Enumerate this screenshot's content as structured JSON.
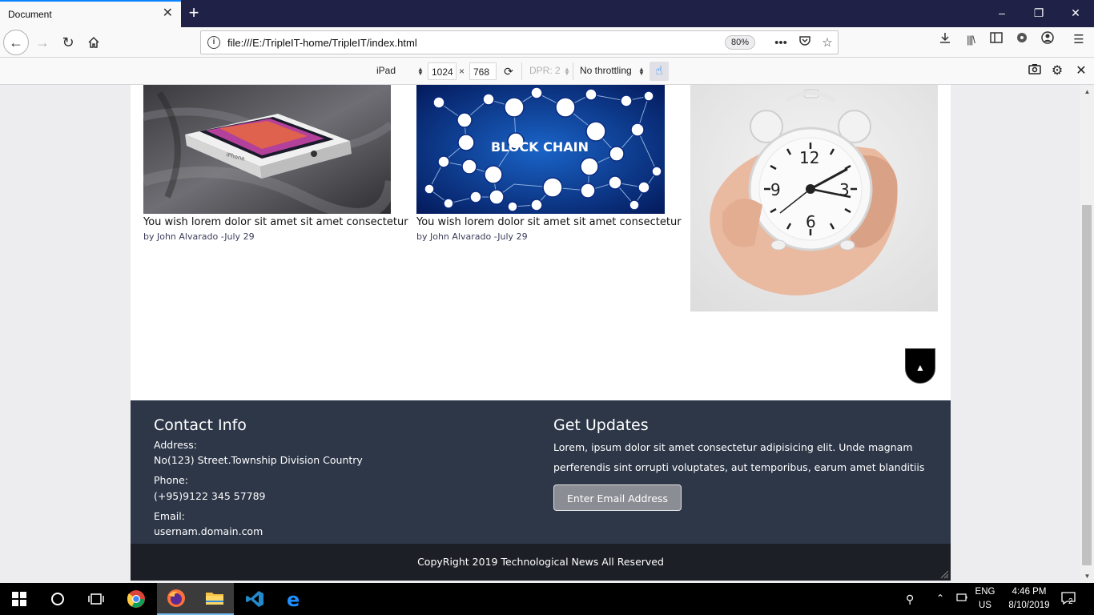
{
  "browser": {
    "tab_title": "Document",
    "url": "file:///E:/TripleIT-home/TripleIT/index.html",
    "zoom": "80%"
  },
  "rdm": {
    "device": "iPad",
    "width": "1024",
    "height": "768",
    "times": "×",
    "dpr": "DPR: 2",
    "throttling": "No throttling"
  },
  "page": {
    "cards": [
      {
        "title": "You wish lorem dolor sit amet sit amet consectetur",
        "meta": "by John Alvarado -July 29",
        "image": "iphone-box-photo"
      },
      {
        "title": "You wish lorem dolor sit amet sit amet consectetur",
        "meta": "by John Alvarado -July 29",
        "image": "blockchain-network-graphic",
        "image_text": "BLOCK CHAIN"
      },
      {
        "image": "alarm-clock-photo"
      }
    ],
    "footer": {
      "contact_heading": "Contact Info",
      "address_label": "Address:",
      "address": "No(123) Street.Township Division Country",
      "phone_label": "Phone:",
      "phone": "(+95)9122 345 57789",
      "email_label": "Email:",
      "email": "usernam.domain.com",
      "updates_heading": "Get Updates",
      "updates_line1": "Lorem, ipsum dolor sit amet consectetur adipisicing elit. Unde magnam",
      "updates_line2": "perferendis sint orrupti voluptates, aut temporibus, earum amet blanditiis",
      "email_placeholder": "Enter Email Address",
      "copyright": "CopyRight 2019 Technological News All Reserved"
    }
  },
  "taskbar": {
    "lang": "ENG",
    "region": "US",
    "time": "4:46 PM",
    "date": "8/10/2019",
    "notifications": "2"
  }
}
